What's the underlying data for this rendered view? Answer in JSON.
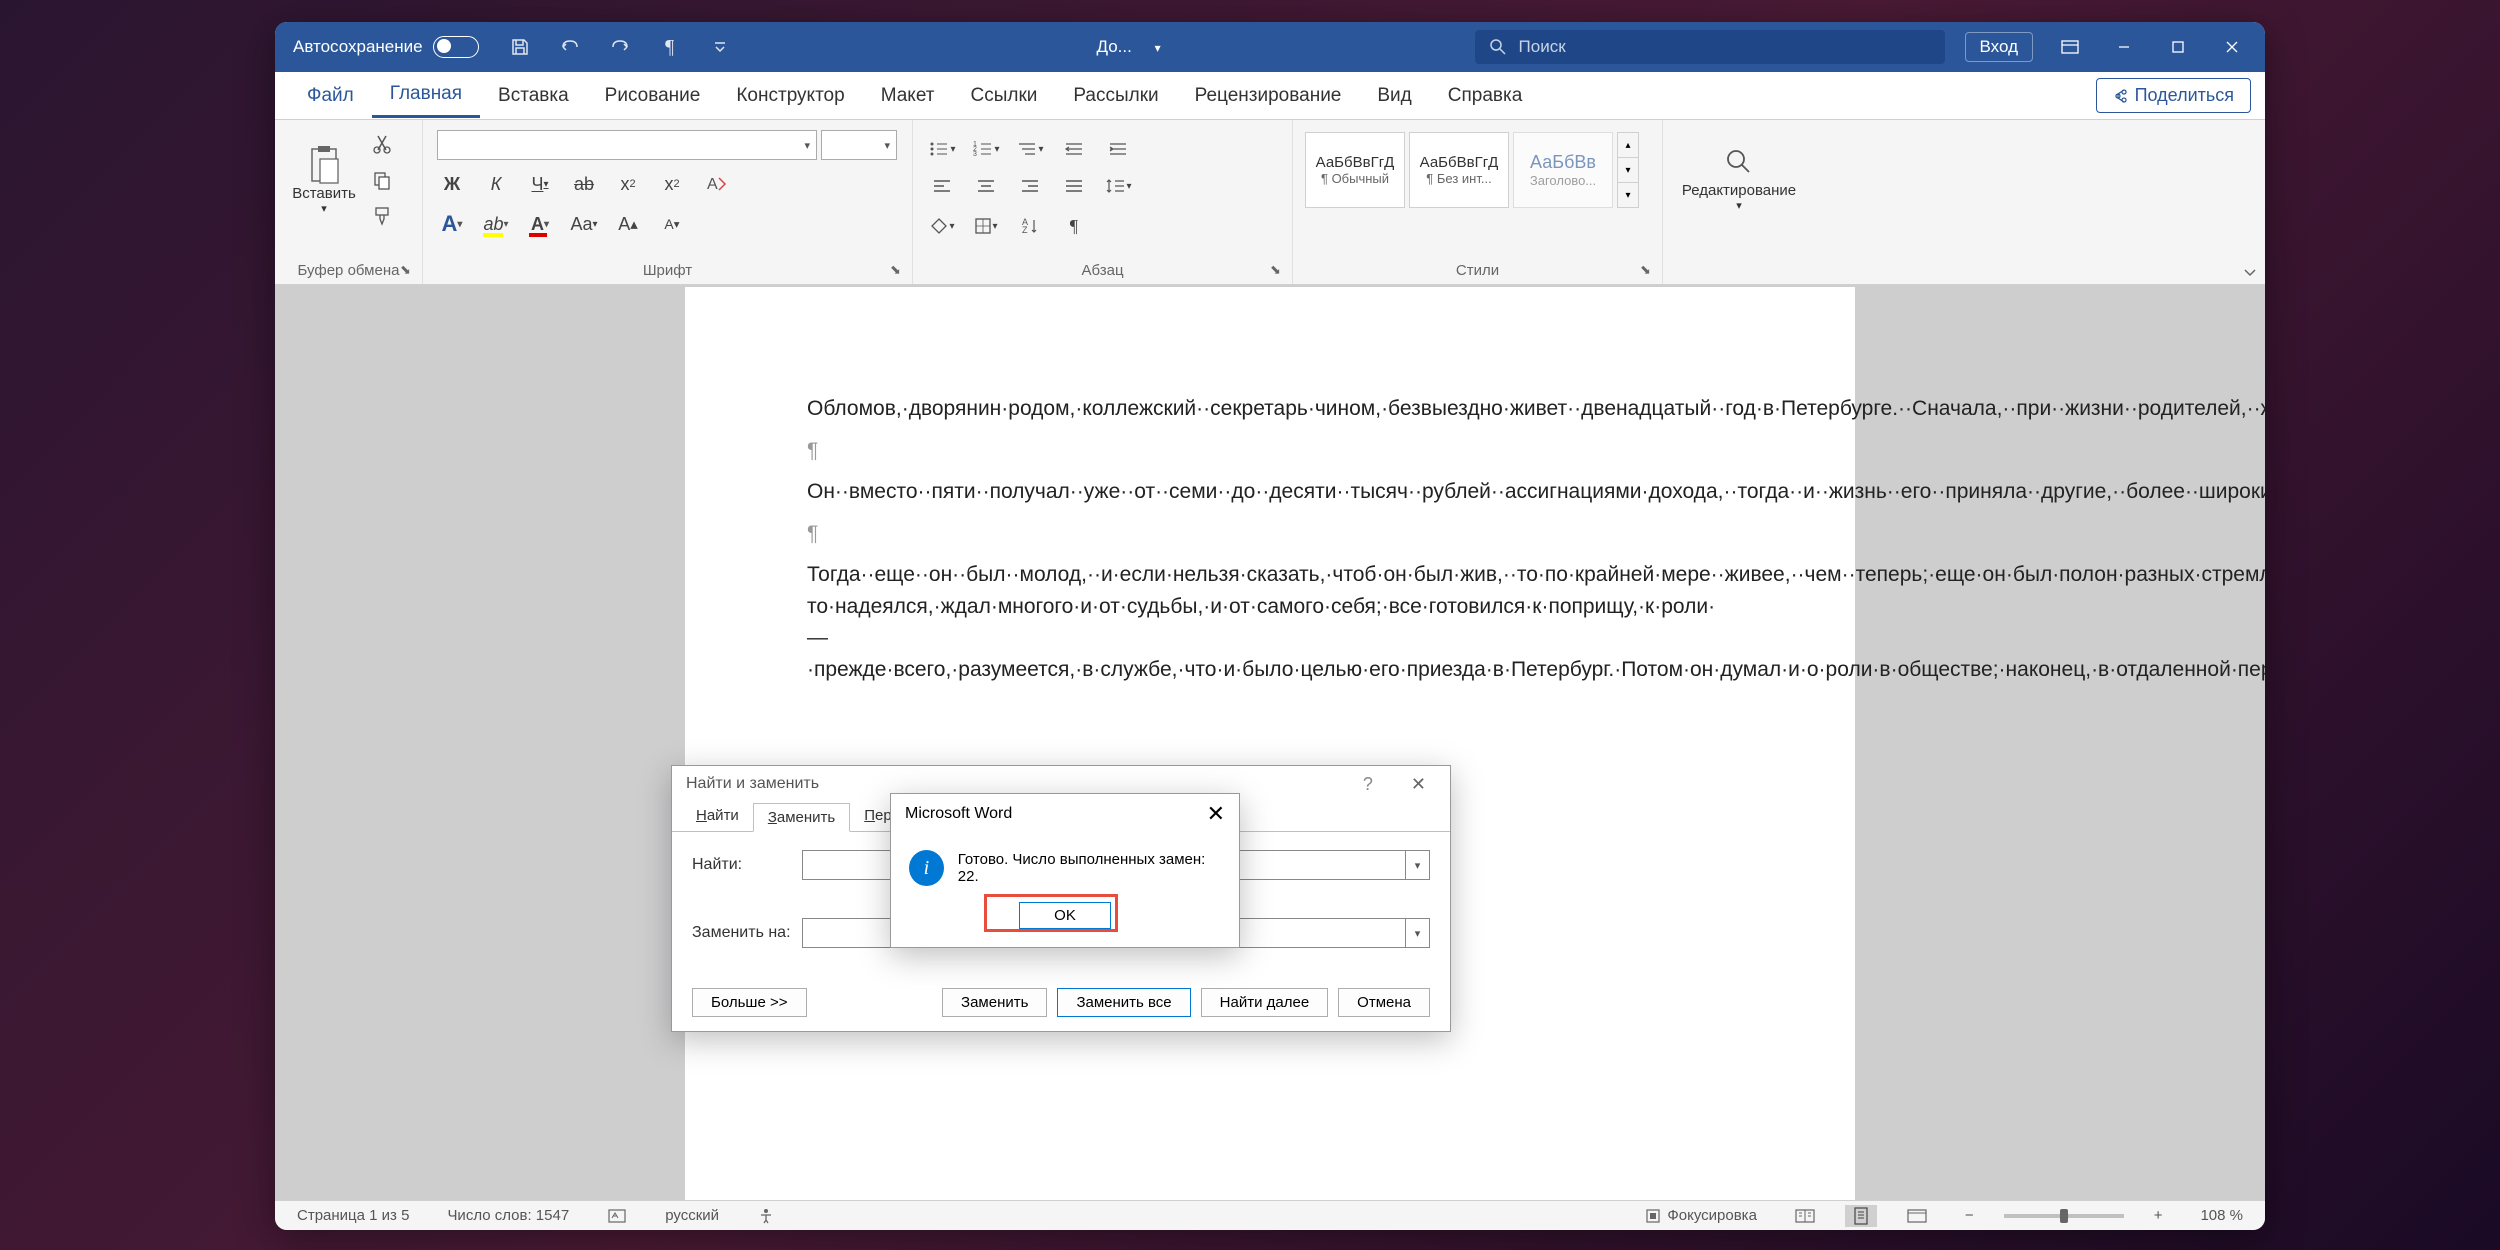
{
  "titlebar": {
    "autosave": "Автосохранение",
    "doc_title": "До...",
    "search_placeholder": "Поиск",
    "login": "Вход"
  },
  "tabs": {
    "file": "Файл",
    "home": "Главная",
    "insert": "Вставка",
    "draw": "Рисование",
    "design": "Конструктор",
    "layout": "Макет",
    "references": "Ссылки",
    "mailings": "Рассылки",
    "review": "Рецензирование",
    "view": "Вид",
    "help": "Справка",
    "share": "Поделиться"
  },
  "ribbon": {
    "clipboard": {
      "paste": "Вставить",
      "label": "Буфер обмена"
    },
    "font": {
      "bold": "Ж",
      "italic": "К",
      "underline": "Ч",
      "label": "Шрифт"
    },
    "paragraph": {
      "label": "Абзац"
    },
    "styles": {
      "label": "Стили",
      "preview": "АаБбВвГгД",
      "preview2": "АаБбВв",
      "normal": "¶ Обычный",
      "nospacing": "¶ Без инт...",
      "heading1": "Заголово..."
    },
    "editing": {
      "label": "Редактирование"
    }
  },
  "document": {
    "p1": "Обломов,·дворянин·родом,·коллежский··секретарь·чином,·безвыездно·живет··двенадцатый··год·в·Петербурге.··Сначала,··при··жизни··родителей,··жил··потеснее,··помещался··в···двух···комнатах,·довольствовался·только·вывезенным·им·из·деревни·слугой·Захаром;·но·по·смерти·отца·и·матери·он·стал·единственным·обладателем·трехсот·пятидесяти·душ,·доставшихся·ему·в·наследство·в·одной·из·отдаленных·губерний,·чуть·не·в·Азии.¶",
    "p2": "Он··вместо··пяти··получал··уже··от··семи··до··десяти··тысяч··рублей··ассигнациями·дохода,··тогда··и··жизнь··его··приняла··другие,··более··широкие·размеры.·Он··нанял·квартиру··побольше,··прибавил··к··своему··штату··еще··повара·и·завел·было··пару·лошадей.¶",
    "p3": "Тогда··еще··он··был··молод,··и·если·нельзя·сказать,·чтоб·он·был·жив,··то·по·крайней·мере··живее,··чем··теперь;·еще·он·был·полон·разных·стремлений,·все·чего-то·надеялся,·ждал·многого·и·от·судьбы,·и·от·самого·себя;·все·готовился·к·поприщу,·к·роли·—·прежде·всего,·разумеется,·в·службе,·что·и·было·целью·его·приезда·в·Петербург.·Потом·он·думал·и·о·роли·в·обществе;·наконец,·в·отдаленной·перспективе,·на·повороте·с·юности·к·зрелым·летам,·воображению·его·мелькало·и·улыбалось·семейное·счастие.¶"
  },
  "find_dialog": {
    "title": "Найти и заменить",
    "tab_find": "Найти",
    "tab_replace": "Заменить",
    "tab_goto": "Перейти",
    "find_label": "Найти:",
    "replace_label": "Заменить на:",
    "more": "Больше >>",
    "replace": "Заменить",
    "replace_all": "Заменить все",
    "find_next": "Найти далее",
    "cancel": "Отмена"
  },
  "msgbox": {
    "title": "Microsoft Word",
    "message": "Готово. Число выполненных замен: 22.",
    "ok": "OK"
  },
  "statusbar": {
    "page": "Страница 1 из 5",
    "words": "Число слов: 1547",
    "lang": "русский",
    "focus": "Фокусировка",
    "zoom": "108 %"
  }
}
